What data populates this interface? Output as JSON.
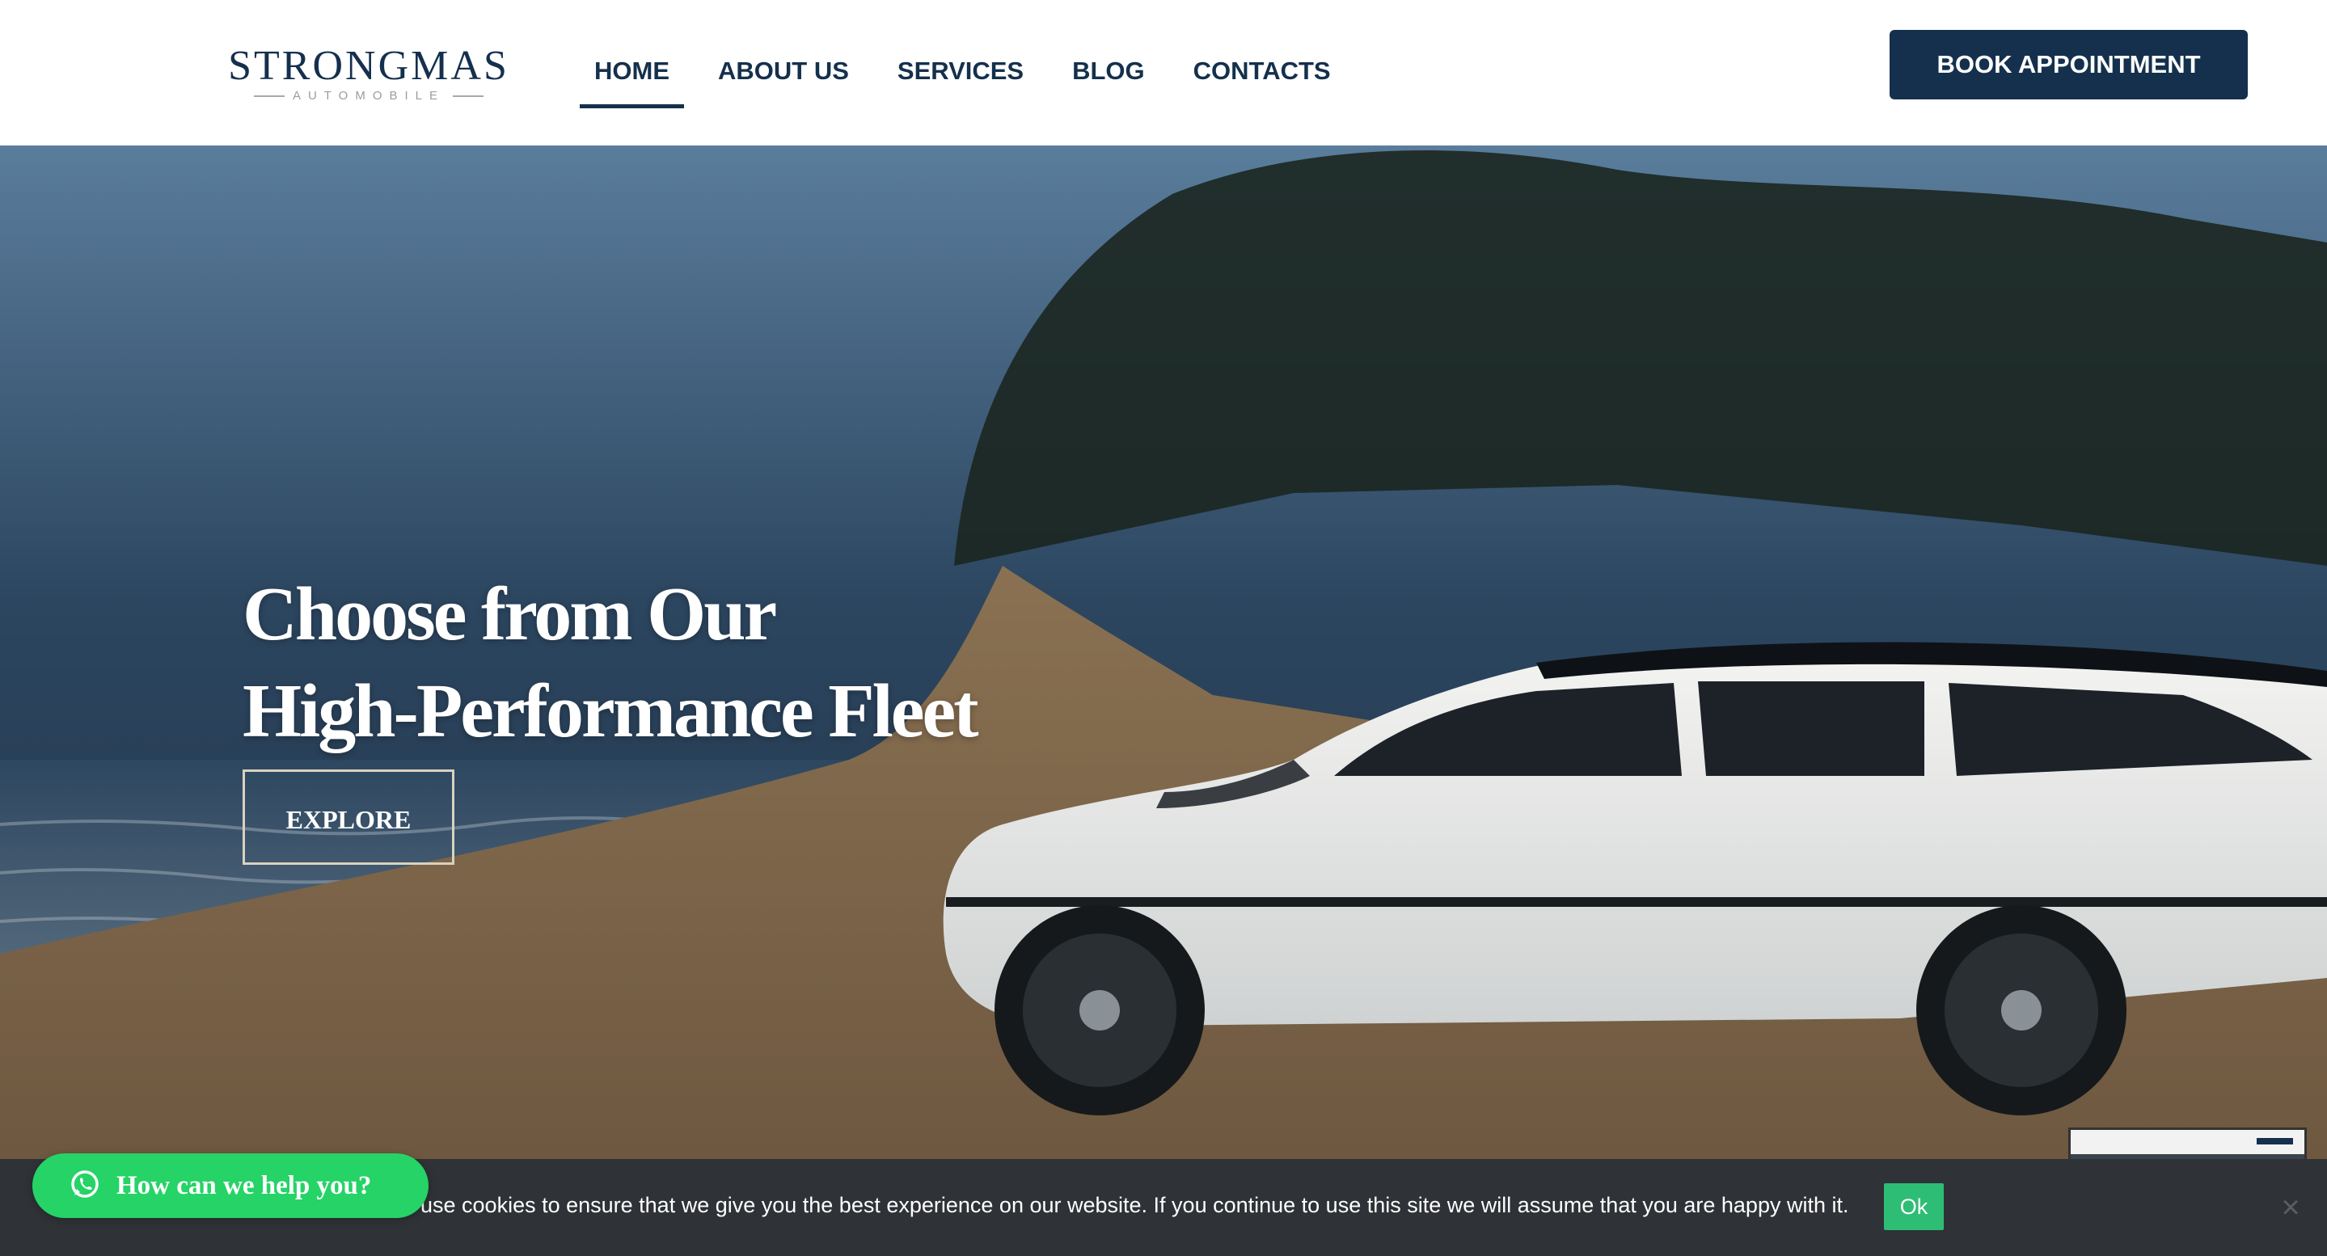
{
  "header": {
    "logo_main": "STRONGMAS",
    "logo_sub": "AUTOMOBILE",
    "nav": [
      {
        "label": "HOME",
        "active": true
      },
      {
        "label": "ABOUT US",
        "active": false
      },
      {
        "label": "SERVICES",
        "active": false
      },
      {
        "label": "BLOG",
        "active": false
      },
      {
        "label": "CONTACTS",
        "active": false
      }
    ],
    "book_label": "BOOK APPOINTMENT"
  },
  "hero": {
    "title_line1": "Choose from Our",
    "title_line2": "High-Performance Fleet",
    "explore_label": "EXPLORE"
  },
  "cookie": {
    "text": "use cookies to ensure that we give you the best experience on our website. If you continue to use this site we will assume that you are happy with it.",
    "ok_label": "Ok",
    "close_icon": "close-icon"
  },
  "whatsapp": {
    "label": "How can we help you?",
    "icon": "whatsapp-icon"
  },
  "colors": {
    "brand": "#14304d",
    "cookie_bg": "#2f3236",
    "ok_green": "#2ebd74",
    "whatsapp_green": "#25d366"
  }
}
